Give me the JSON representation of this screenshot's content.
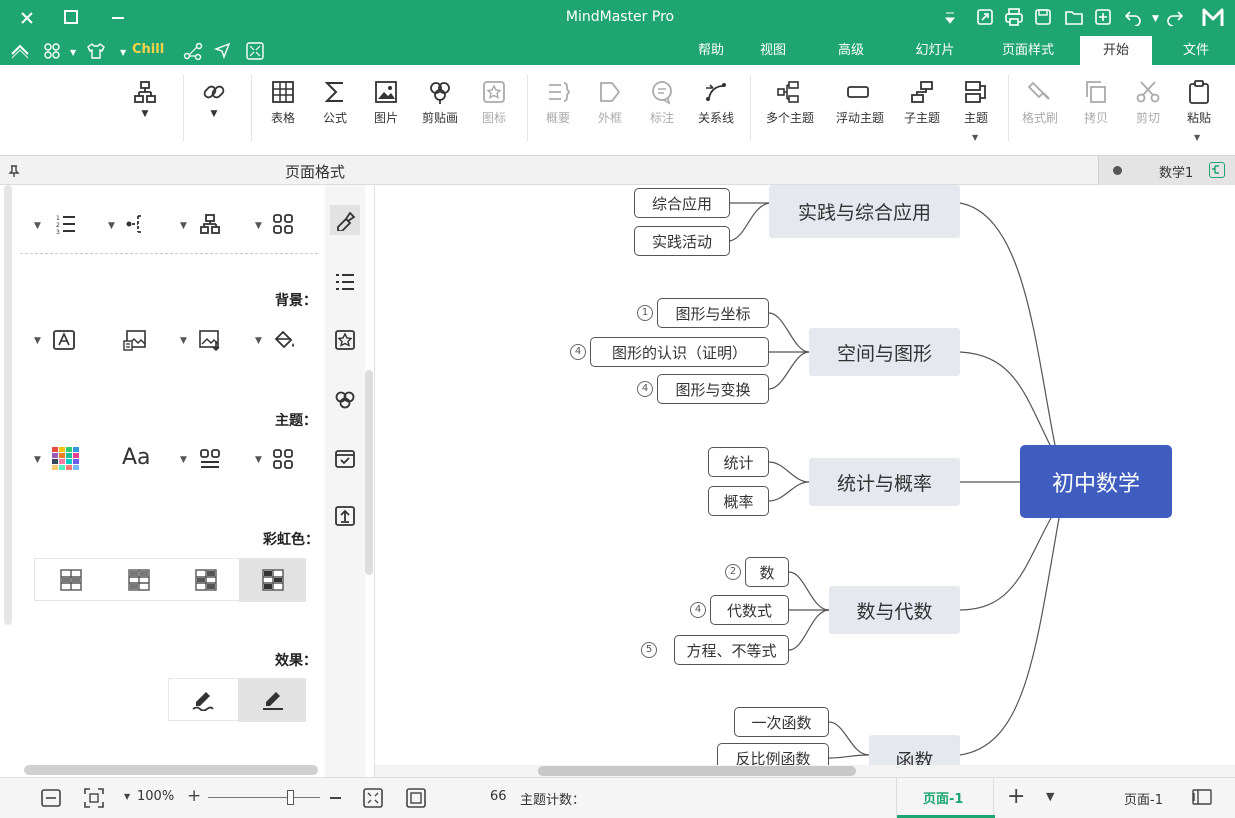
{
  "app": {
    "title": "MindMaster Pro"
  },
  "tabs": [
    {
      "label": "文件"
    },
    {
      "label": "开始"
    },
    {
      "label": "页面样式"
    },
    {
      "label": "幻灯片"
    },
    {
      "label": "高级"
    },
    {
      "label": "视图"
    },
    {
      "label": "帮助"
    }
  ],
  "quickbar": {
    "theme_label": "Chill"
  },
  "ribbon": {
    "paste": "粘贴",
    "cut": "剪切",
    "copy": "拷贝",
    "format_painter": "格式刷",
    "topic": "主题",
    "subtopic": "子主题",
    "floating": "浮动主题",
    "multi": "多个主题",
    "relationship": "关系线",
    "callout": "标注",
    "boundary": "外框",
    "summary": "概要",
    "icon": "图标",
    "clipart": "剪贴画",
    "picture": "图片",
    "formula": "公式",
    "table": "表格"
  },
  "doc": {
    "tab_label": "数学1"
  },
  "sidebar": {
    "title": "页面格式",
    "background_label": "背景：",
    "theme_label": "主题：",
    "rainbow_label": "彩虹色：",
    "effect_label": "效果："
  },
  "mindmap": {
    "root": "初中数学",
    "branches": [
      {
        "label": "实践与综合应用",
        "children": [
          {
            "label": "综合应用"
          },
          {
            "label": "实践活动"
          }
        ]
      },
      {
        "label": "空间与图形",
        "children": [
          {
            "label": "图形与坐标",
            "badge": "1"
          },
          {
            "label": "图形的认识（证明）",
            "badge": "4"
          },
          {
            "label": "图形与变换",
            "badge": "4"
          }
        ]
      },
      {
        "label": "统计与概率",
        "children": [
          {
            "label": "统计"
          },
          {
            "label": "概率"
          }
        ]
      },
      {
        "label": "数与代数",
        "children": [
          {
            "label": "数",
            "badge": "2"
          },
          {
            "label": "代数式",
            "badge": "4"
          },
          {
            "label": "方程、不等式",
            "badge": "5"
          }
        ]
      },
      {
        "label": "函数",
        "children": [
          {
            "label": "一次函数"
          },
          {
            "label": "反比例函数"
          }
        ]
      }
    ]
  },
  "status": {
    "page_label": "页面-1",
    "page_tab": "页面-1",
    "topic_count_label": "主题计数：",
    "topic_count": "66",
    "zoom": "100%"
  },
  "colors": {
    "brand": "#1fa572",
    "root": "#3f5dbf",
    "main_topic": "#e6e8f0"
  }
}
